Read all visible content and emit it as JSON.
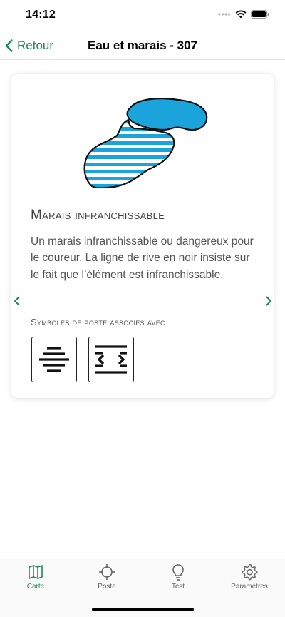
{
  "status_bar": {
    "time": "14:12"
  },
  "nav": {
    "back_label": "Retour",
    "title": "Eau et marais - 307"
  },
  "card": {
    "title": "Marais infranchissable",
    "description": "Un marais infranchissable ou dangereux pour le coureur. La ligne de rive en noir insiste sur le fait que l’élément est infranchissable.",
    "symbols_title": "Symboles de poste associés avec",
    "symbols": [
      "symbol-marsh-horizontal-lines",
      "symbol-marsh-bracket-lines"
    ]
  },
  "tabs": [
    {
      "label": "Carte",
      "icon": "map-icon",
      "active": true
    },
    {
      "label": "Poste",
      "icon": "crosshair-icon",
      "active": false
    },
    {
      "label": "Test",
      "icon": "lightbulb-icon",
      "active": false
    },
    {
      "label": "Paramètres",
      "icon": "gear-icon",
      "active": false
    }
  ],
  "colors": {
    "accent": "#1e8a57",
    "water": "#1ba3dc",
    "text": "#555555"
  }
}
